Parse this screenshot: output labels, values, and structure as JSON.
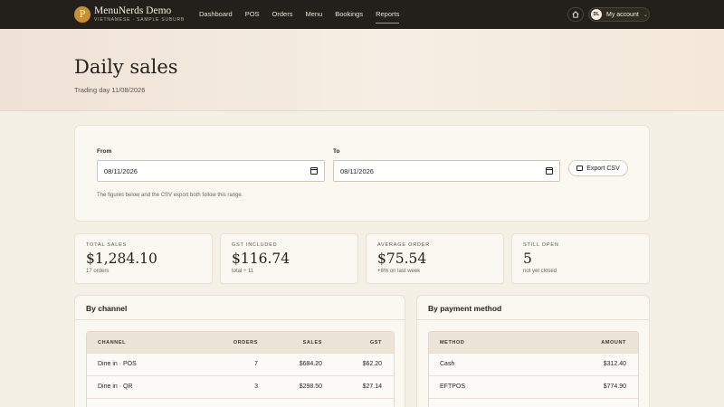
{
  "brand": {
    "logo_letter": "P",
    "title": "MenuNerds Demo",
    "subtitle": "VIETNAMESE · SAMPLE SUBURB"
  },
  "nav": {
    "items": [
      "Dashboard",
      "POS",
      "Orders",
      "Menu",
      "Bookings",
      "Reports"
    ],
    "active": "Reports"
  },
  "account": {
    "initials": "DL",
    "label": "My account",
    "chevron": "⌄"
  },
  "page": {
    "title": "Daily sales",
    "subtitle": "Trading day 11/08/2026"
  },
  "filter": {
    "from_label": "From",
    "from_value": "08/11/2026",
    "to_label": "To",
    "to_value": "08/11/2026",
    "export_label": "Export CSV",
    "note": "The figures below and the CSV export both follow this range."
  },
  "stats": [
    {
      "label": "TOTAL SALES",
      "value": "$1,284.10",
      "note": "17 orders"
    },
    {
      "label": "GST INCLUDED",
      "value": "$116.74",
      "note": "total ÷ 11"
    },
    {
      "label": "AVERAGE ORDER",
      "value": "$75.54",
      "note": "+8% on last week"
    },
    {
      "label": "STILL OPEN",
      "value": "5",
      "note": "not yet closed"
    }
  ],
  "by_channel": {
    "title": "By channel",
    "headers": [
      "CHANNEL",
      "ORDERS",
      "SALES",
      "GST"
    ],
    "rows": [
      [
        "Dine in · POS",
        "7",
        "$684.20",
        "$62.20"
      ],
      [
        "Dine in · QR",
        "3",
        "$298.50",
        "$27.14"
      ]
    ]
  },
  "by_payment": {
    "title": "By payment method",
    "headers": [
      "METHOD",
      "AMOUNT"
    ],
    "rows": [
      [
        "Cash",
        "$312.40"
      ],
      [
        "EFTPOS",
        "$774.90"
      ]
    ]
  },
  "colors": {
    "nav_bg": "#231f1a",
    "accent": "#c8912f",
    "page_bg": "#f5f0e6"
  }
}
